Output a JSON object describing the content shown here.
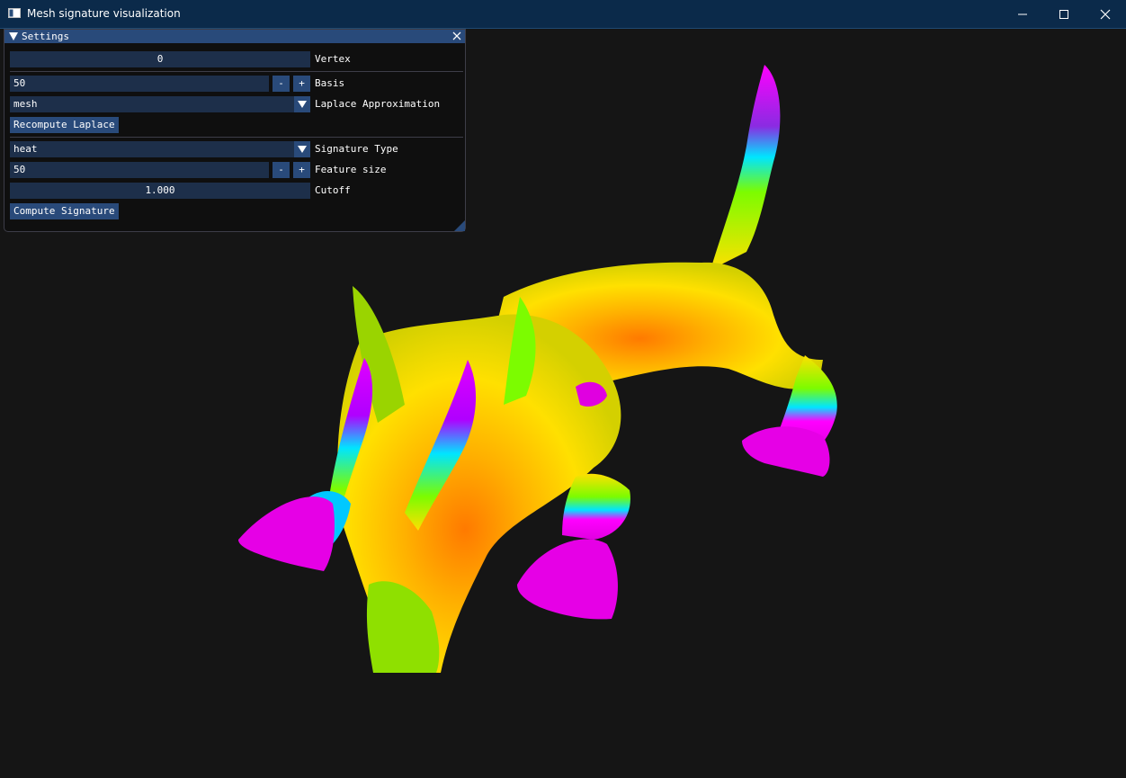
{
  "window": {
    "title": "Mesh signature visualization",
    "icons": {
      "app": "app-window-icon",
      "minimize": "minimize-icon",
      "maximize": "maximize-icon",
      "close": "close-icon"
    }
  },
  "panel": {
    "title": "Settings",
    "close_icon": "close-icon",
    "vertex": {
      "value": "0",
      "label": "Vertex"
    },
    "basis": {
      "value": "50",
      "minus": "-",
      "plus": "+",
      "label": "Basis"
    },
    "laplace": {
      "value": "mesh",
      "label": "Laplace Approximation"
    },
    "recompute_button": "Recompute Laplace",
    "signature_type": {
      "value": "heat",
      "label": "Signature Type"
    },
    "feature_size": {
      "value": "50",
      "minus": "-",
      "plus": "+",
      "label": "Feature size"
    },
    "cutoff": {
      "value": "1.000",
      "label": "Cutoff"
    },
    "compute_button": "Compute Signature"
  },
  "colors": {
    "titlebar": "#0b2a4a",
    "panel_header": "#294a7a",
    "field_bg": "#1d2f4a",
    "viewport_bg": "#151515",
    "mesh_colormap": [
      "#ff00ff",
      "#00e0ff",
      "#7cfc00",
      "#ffe000",
      "#ff8c00"
    ]
  },
  "viewport": {
    "content": "3d-mesh-model-icon"
  }
}
